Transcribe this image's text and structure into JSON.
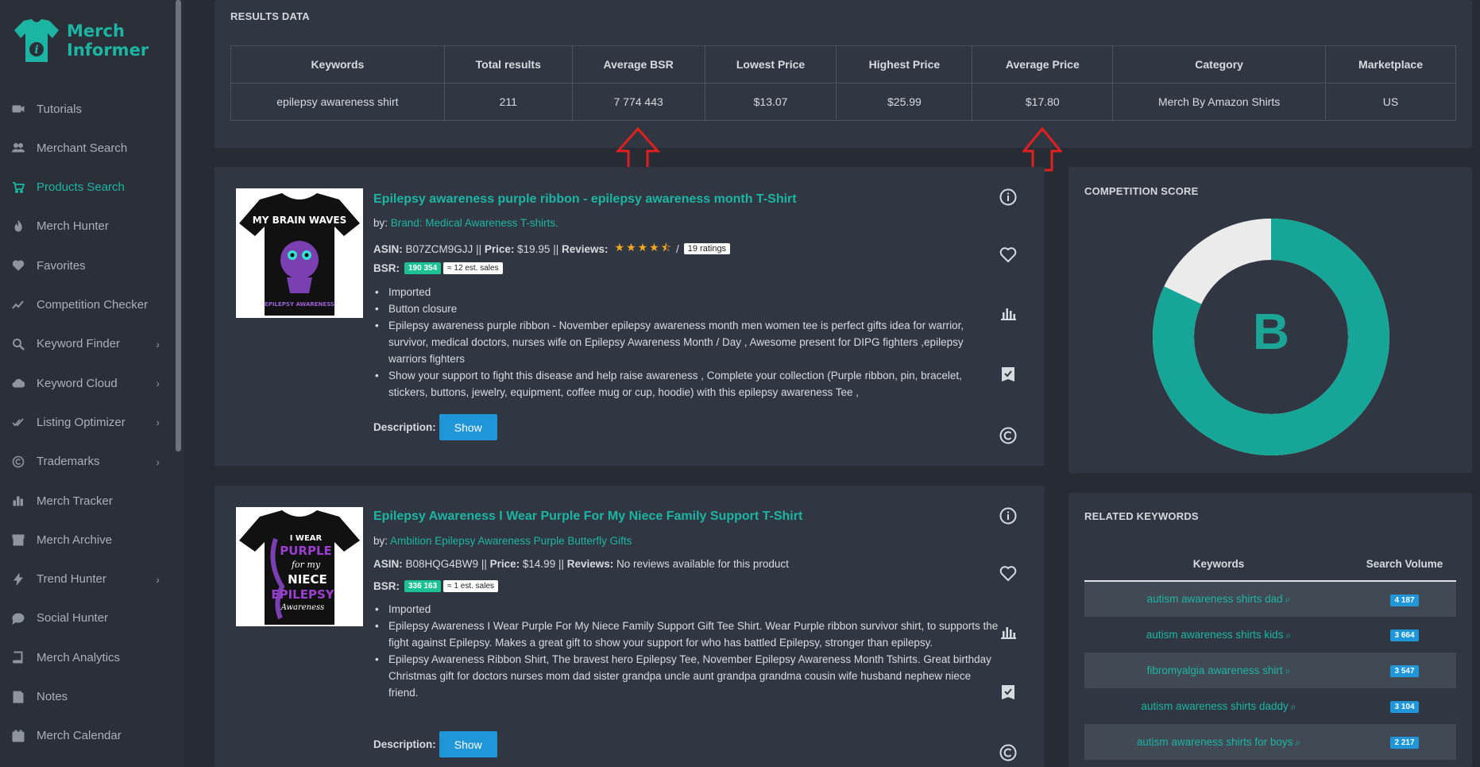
{
  "brand": {
    "line1": "Merch",
    "line2": "Informer",
    "accent": "#1cb5a3"
  },
  "nav": [
    {
      "label": "Tutorials",
      "icon": "video-icon",
      "expandable": false,
      "active": false
    },
    {
      "label": "Merchant Search",
      "icon": "users-icon",
      "expandable": false,
      "active": false
    },
    {
      "label": "Products Search",
      "icon": "cart-icon",
      "expandable": false,
      "active": true
    },
    {
      "label": "Merch Hunter",
      "icon": "fire-icon",
      "expandable": false,
      "active": false
    },
    {
      "label": "Favorites",
      "icon": "heart-icon",
      "expandable": false,
      "active": false
    },
    {
      "label": "Competition Checker",
      "icon": "trend-icon",
      "expandable": false,
      "active": false
    },
    {
      "label": "Keyword Finder",
      "icon": "search-icon",
      "expandable": true,
      "active": false
    },
    {
      "label": "Keyword Cloud",
      "icon": "cloud-icon",
      "expandable": true,
      "active": false
    },
    {
      "label": "Listing Optimizer",
      "icon": "double-check-icon",
      "expandable": true,
      "active": false
    },
    {
      "label": "Trademarks",
      "icon": "copyright-icon",
      "expandable": true,
      "active": false
    },
    {
      "label": "Merch Tracker",
      "icon": "bars-icon",
      "expandable": false,
      "active": false
    },
    {
      "label": "Merch Archive",
      "icon": "archive-icon",
      "expandable": false,
      "active": false
    },
    {
      "label": "Trend Hunter",
      "icon": "bolt-icon",
      "expandable": true,
      "active": false
    },
    {
      "label": "Social Hunter",
      "icon": "chat-icon",
      "expandable": false,
      "active": false
    },
    {
      "label": "Merch Analytics",
      "icon": "book-icon",
      "expandable": false,
      "active": false
    },
    {
      "label": "Notes",
      "icon": "note-icon",
      "expandable": false,
      "active": false
    },
    {
      "label": "Merch Calendar",
      "icon": "calendar-icon",
      "expandable": false,
      "active": false
    }
  ],
  "results": {
    "title": "RESULTS DATA",
    "headers": [
      "Keywords",
      "Total results",
      "Average BSR",
      "Lowest Price",
      "Highest Price",
      "Average Price",
      "Category",
      "Marketplace"
    ],
    "row": [
      "epilepsy awareness shirt",
      "211",
      "7 774 443",
      "$13.07",
      "$25.99",
      "$17.80",
      "Merch By Amazon Shirts",
      "US"
    ]
  },
  "products": [
    {
      "title": "Epilepsy awareness purple ribbon - epilepsy awareness month T-Shirt",
      "by_prefix": "by: ",
      "brand": "Brand: Medical Awareness T-shirts.",
      "asin_label": "ASIN:",
      "asin": "B07ZCM9GJJ",
      "sep": "||",
      "price_label": "Price:",
      "price": "$19.95",
      "reviews_label": "Reviews:",
      "stars": "★★★★⯪",
      "ratings_slash": "/",
      "ratings": "19 ratings",
      "bsr_label": "BSR:",
      "bsr": "190 354",
      "est_sales": "≈ 12 est. sales",
      "bullets": [
        "Imported",
        "Button closure",
        "Epilepsy awareness purple ribbon - November epilepsy awareness month men women tee is perfect gifts idea for warrior, survivor, medical doctors, nurses wife on Epilepsy Awareness Month / Day , Awesome present for DIPG fighters ,epilepsy warriors fighters",
        "Show your support to fight this disease and help raise awareness , Complete your collection (Purple ribbon, pin, bracelet, stickers, buttons, jewelry, equipment, coffee mug or cup, hoodie) with this epilepsy awareness Tee ,"
      ],
      "desc_label": "Description:",
      "show_label": "Show",
      "shirt_lines": [
        "MY BRAIN WAVES",
        "EPILEPSY AWARENESS"
      ]
    },
    {
      "title": "Epilepsy Awareness I Wear Purple For My Niece Family Support T-Shirt",
      "by_prefix": "by: ",
      "brand": "Ambition Epilepsy Awareness Purple Butterfly Gifts",
      "asin_label": "ASIN:",
      "asin": "B08HQG4BW9",
      "sep": "||",
      "price_label": "Price:",
      "price": "$14.99",
      "reviews_label": "Reviews:",
      "reviews_text": "No reviews available for this product",
      "bsr_label": "BSR:",
      "bsr": "336 163",
      "est_sales": "≈ 1 est. sales",
      "bullets": [
        "Imported",
        "Epilepsy Awareness I Wear Purple For My Niece Family Support Gift Tee Shirt. Wear Purple ribbon survivor shirt, to supports the fight against Epilepsy. Makes a great gift to show your support for who has battled Epilepsy, stronger than epilepsy.",
        "Epilepsy Awareness Ribbon Shirt, The bravest hero Epilepsy Tee, November Epilepsy Awareness Month Tshirts. Great birthday Christmas gift for doctors nurses mom dad sister grandpa uncle aunt grandpa grandma cousin wife husband nephew niece friend."
      ],
      "desc_label": "Description:",
      "show_label": "Show",
      "shirt_lines": [
        "I WEAR",
        "PURPLE",
        "for my",
        "NIECE",
        "EPILEPSY",
        "Awareness"
      ]
    }
  ],
  "competition": {
    "title": "COMPETITION SCORE",
    "grade": "B",
    "score_fraction": 0.82,
    "fill_color": "#16a697",
    "rest_color": "#ebebeb"
  },
  "related": {
    "title": "RELATED KEYWORDS",
    "headers": [
      "Keywords",
      "Search Volume"
    ],
    "rows": [
      {
        "keyword": "autism awareness shirts dad",
        "volume": "4 187"
      },
      {
        "keyword": "autism awareness shirts kids",
        "volume": "3 664"
      },
      {
        "keyword": "fibromyalgia awareness shirt",
        "volume": "3 547"
      },
      {
        "keyword": "autism awareness shirts daddy",
        "volume": "3 104"
      },
      {
        "keyword": "autism awareness shirts for boys",
        "volume": "2 217"
      }
    ]
  }
}
